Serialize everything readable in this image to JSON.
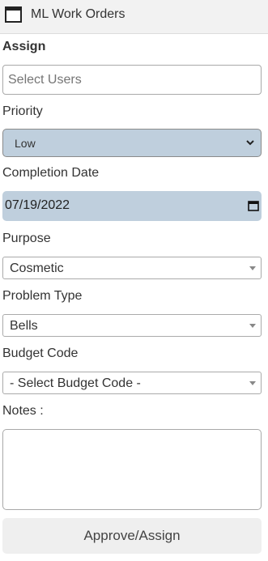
{
  "window": {
    "title": "ML Work Orders",
    "icon": "window-icon"
  },
  "form": {
    "assign": {
      "label": "Assign",
      "placeholder": "Select Users",
      "value": ""
    },
    "priority": {
      "label": "Priority",
      "value": "Low",
      "options": [
        "Low"
      ]
    },
    "completion_date": {
      "label": "Completion Date",
      "value": "07/19/2022"
    },
    "purpose": {
      "label": "Purpose",
      "value": "Cosmetic"
    },
    "problem_type": {
      "label": "Problem Type",
      "value": "Bells"
    },
    "budget_code": {
      "label": "Budget Code",
      "value": "- Select Budget Code -"
    },
    "notes": {
      "label": "Notes :",
      "value": ""
    },
    "submit_label": "Approve/Assign"
  },
  "colors": {
    "field_highlight": "#bfcfdd",
    "titlebar_bg": "#f2f2f2",
    "button_bg": "#efefef"
  }
}
